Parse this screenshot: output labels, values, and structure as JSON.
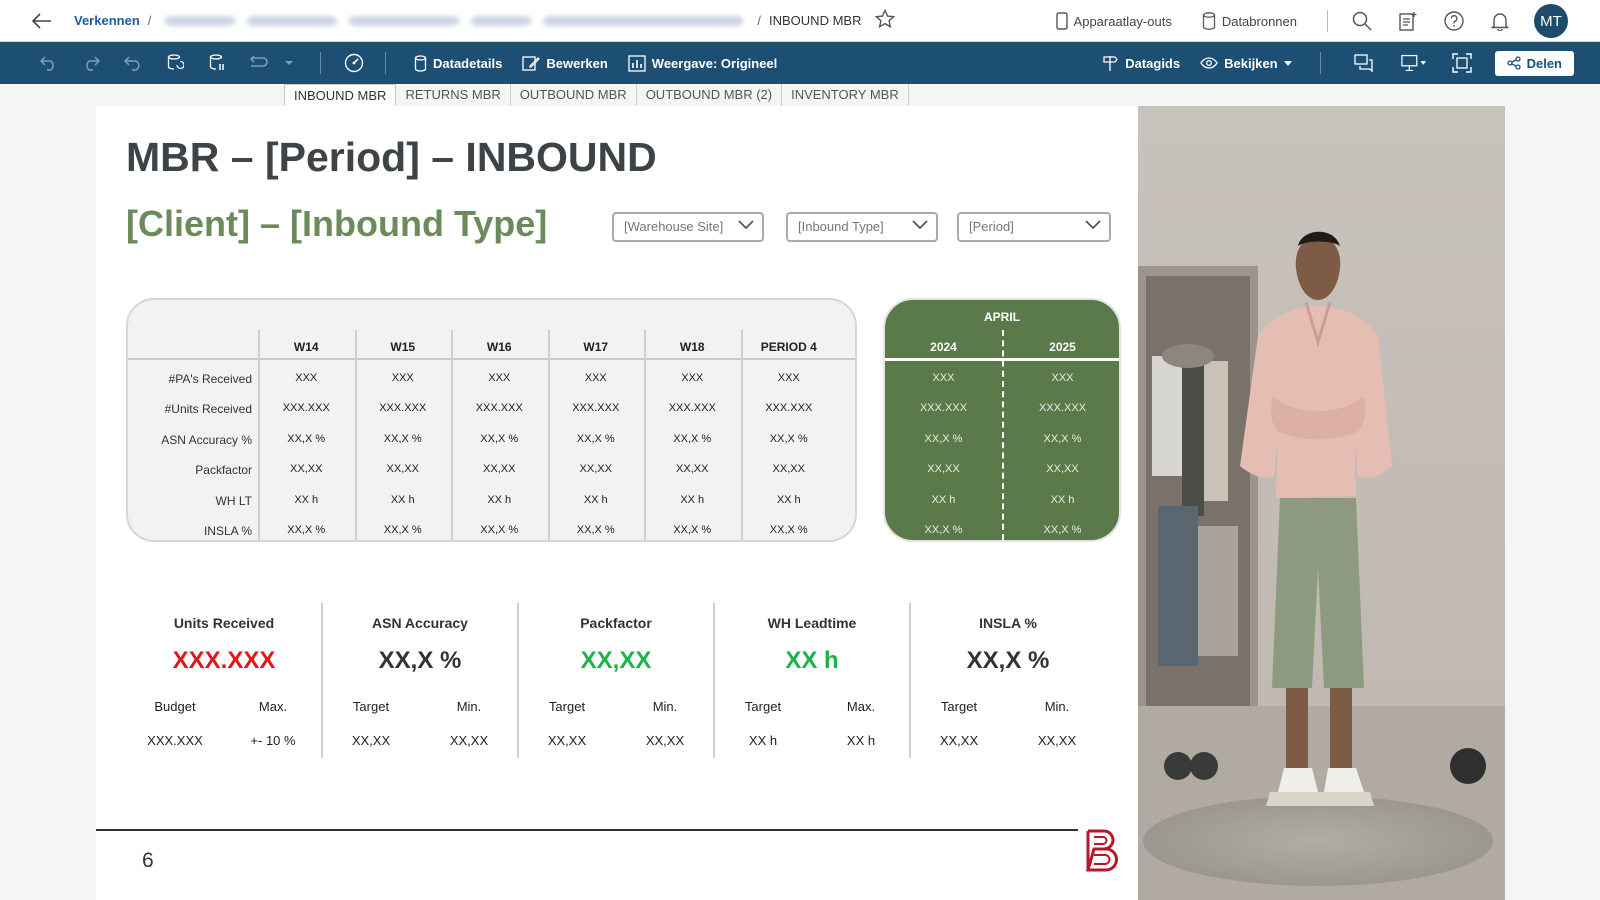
{
  "topbar": {
    "back_label": "Terug",
    "crumb_explore": "Verkennen",
    "crumb_current": "INBOUND MBR",
    "device_layouts": "Apparaatlay-outs",
    "data_sources": "Databronnen",
    "avatar_initials": "MT"
  },
  "toolbar": {
    "data_details": "Datadetails",
    "edit": "Bewerken",
    "view": "Weergave: Origineel",
    "data_guide": "Datagids",
    "watch": "Bekijken",
    "share": "Delen"
  },
  "tabs": [
    "INBOUND MBR",
    "RETURNS MBR",
    "OUTBOUND MBR",
    "OUTBOUND MBR (2)",
    "INVENTORY MBR"
  ],
  "sheet": {
    "title": "MBR – [Period] – INBOUND",
    "subtitle": "[Client] – [Inbound Type]",
    "filters": [
      "[Warehouse Site]",
      "[Inbound Type]",
      "[Period]"
    ],
    "weekly_table": {
      "columns": [
        "W14",
        "W15",
        "W16",
        "W17",
        "W18",
        "PERIOD 4"
      ],
      "rows": [
        {
          "label": "#PA's Received",
          "values": [
            "XXX",
            "XXX",
            "XXX",
            "XXX",
            "XXX",
            "XXX"
          ]
        },
        {
          "label": "#Units Received",
          "values": [
            "XXX.XXX",
            "XXX.XXX",
            "XXX.XXX",
            "XXX.XXX",
            "XXX.XXX",
            "XXX.XXX"
          ]
        },
        {
          "label": "ASN Accuracy %",
          "values": [
            "XX,X %",
            "XX,X %",
            "XX,X %",
            "XX,X %",
            "XX,X %",
            "XX,X %"
          ]
        },
        {
          "label": "Packfactor",
          "values": [
            "XX,XX",
            "XX,XX",
            "XX,XX",
            "XX,XX",
            "XX,XX",
            "XX,XX"
          ]
        },
        {
          "label": "WH LT",
          "values": [
            "XX h",
            "XX h",
            "XX h",
            "XX h",
            "XX h",
            "XX h"
          ]
        },
        {
          "label": "INSLA %",
          "values": [
            "XX,X %",
            "XX,X %",
            "XX,X %",
            "XX,X %",
            "XX,X %",
            "XX,X %"
          ]
        }
      ]
    },
    "april_table": {
      "month": "APRIL",
      "years": [
        "2024",
        "2025"
      ],
      "rows": [
        [
          "XXX",
          "XXX"
        ],
        [
          "XXX.XXX",
          "XXX.XXX"
        ],
        [
          "XX,X %",
          "XX,X %"
        ],
        [
          "XX,XX",
          "XX,XX"
        ],
        [
          "XX h",
          "XX h"
        ],
        [
          "XX,X %",
          "XX,X %"
        ]
      ]
    },
    "kpis": [
      {
        "title": "Units Received",
        "value": "XXX.XXX",
        "color": "#e8141b",
        "sub_labels": [
          "Budget",
          "Max."
        ],
        "sub_values": [
          "XXX.XXX",
          "+- 10 %"
        ]
      },
      {
        "title": "ASN Accuracy",
        "value": "XX,X %",
        "color": "#333333",
        "sub_labels": [
          "Target",
          "Min."
        ],
        "sub_values": [
          "XX,XX",
          "XX,XX"
        ]
      },
      {
        "title": "Packfactor",
        "value": "XX,XX",
        "color": "#1db34a",
        "sub_labels": [
          "Target",
          "Min."
        ],
        "sub_values": [
          "XX,XX",
          "XX,XX"
        ]
      },
      {
        "title": "WH Leadtime",
        "value": "XX h",
        "color": "#1db34a",
        "sub_labels": [
          "Target",
          "Max."
        ],
        "sub_values": [
          "XX h",
          "XX h"
        ]
      },
      {
        "title": "INSLA %",
        "value": "XX,X %",
        "color": "#333333",
        "sub_labels": [
          "Target",
          "Min."
        ],
        "sub_values": [
          "XX,XX",
          "XX,XX"
        ]
      }
    ],
    "page_number": "6"
  },
  "colors": {
    "toolbar": "#1c4f73",
    "accent_green": "#5a7a4a",
    "subtitle_green": "#6b8c5a",
    "logo_red": "#b5172b"
  }
}
